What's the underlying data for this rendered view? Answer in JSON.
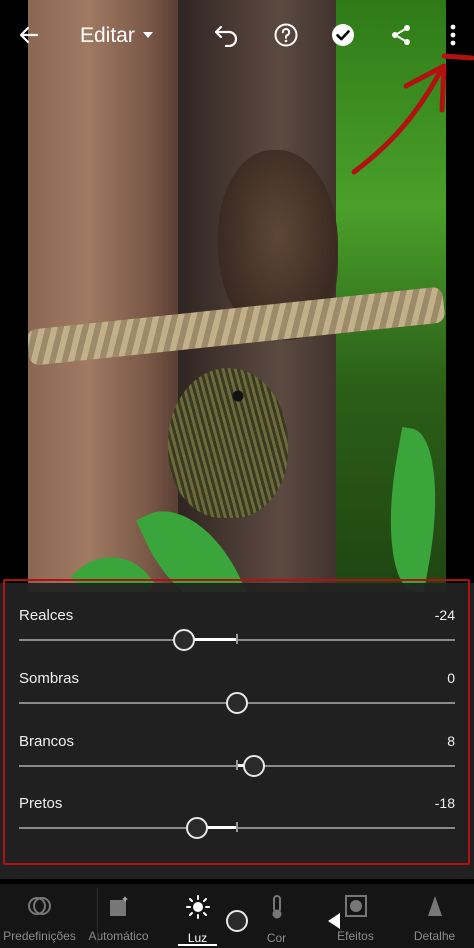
{
  "header": {
    "title": "Editar",
    "icons": [
      "back-arrow-icon",
      "chevron-down-icon",
      "undo-icon",
      "help-icon",
      "check-icon",
      "share-icon",
      "more-vert-icon"
    ]
  },
  "sliders": [
    {
      "label": "Realces",
      "value": "-24"
    },
    {
      "label": "Sombras",
      "value": "0"
    },
    {
      "label": "Brancos",
      "value": "8"
    },
    {
      "label": "Pretos",
      "value": "-18"
    }
  ],
  "toolbar": {
    "items": [
      {
        "label": "Predefinições",
        "icon": "presets-icon",
        "active": false
      },
      {
        "label": "Automático",
        "icon": "auto-icon",
        "active": false
      },
      {
        "label": "Luz",
        "icon": "light-sun-icon",
        "active": true
      },
      {
        "label": "Cor",
        "icon": "thermometer-icon",
        "active": false
      },
      {
        "label": "Efeitos",
        "icon": "effects-icon",
        "active": false
      },
      {
        "label": "Detalhe",
        "icon": "detail-triangle-icon",
        "active": false
      }
    ]
  },
  "colors": {
    "annotation": "#b01212",
    "panel": "#222222",
    "toolbar": "#151515"
  }
}
